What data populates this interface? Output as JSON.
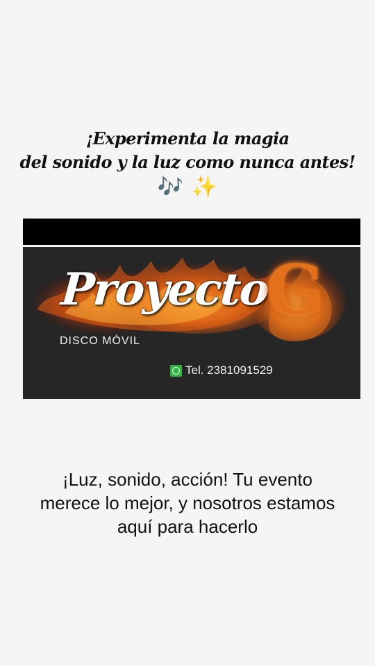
{
  "headline": {
    "line1": "¡Experimenta la magia",
    "line2": "del sonido y la luz como nunca antes!"
  },
  "emojis": {
    "music_notes": "🎶",
    "sparkles": "✨"
  },
  "banner": {
    "brand_main": "Proyecto",
    "brand_letter": "G",
    "subtitle": "DISCO MÓVIL",
    "phone": "Tel. 2381091529",
    "phone_icon": "whatsapp-icon"
  },
  "tagline": {
    "line1": "¡Luz, sonido, acción! Tu evento",
    "line2": "merece lo mejor, y nosotros estamos",
    "line3": "aquí para hacerlo"
  },
  "colors": {
    "background": "#f5f5f5",
    "banner_bg": "#262626",
    "flame_orange": "#e3701a",
    "whatsapp_green": "#2fb543"
  }
}
